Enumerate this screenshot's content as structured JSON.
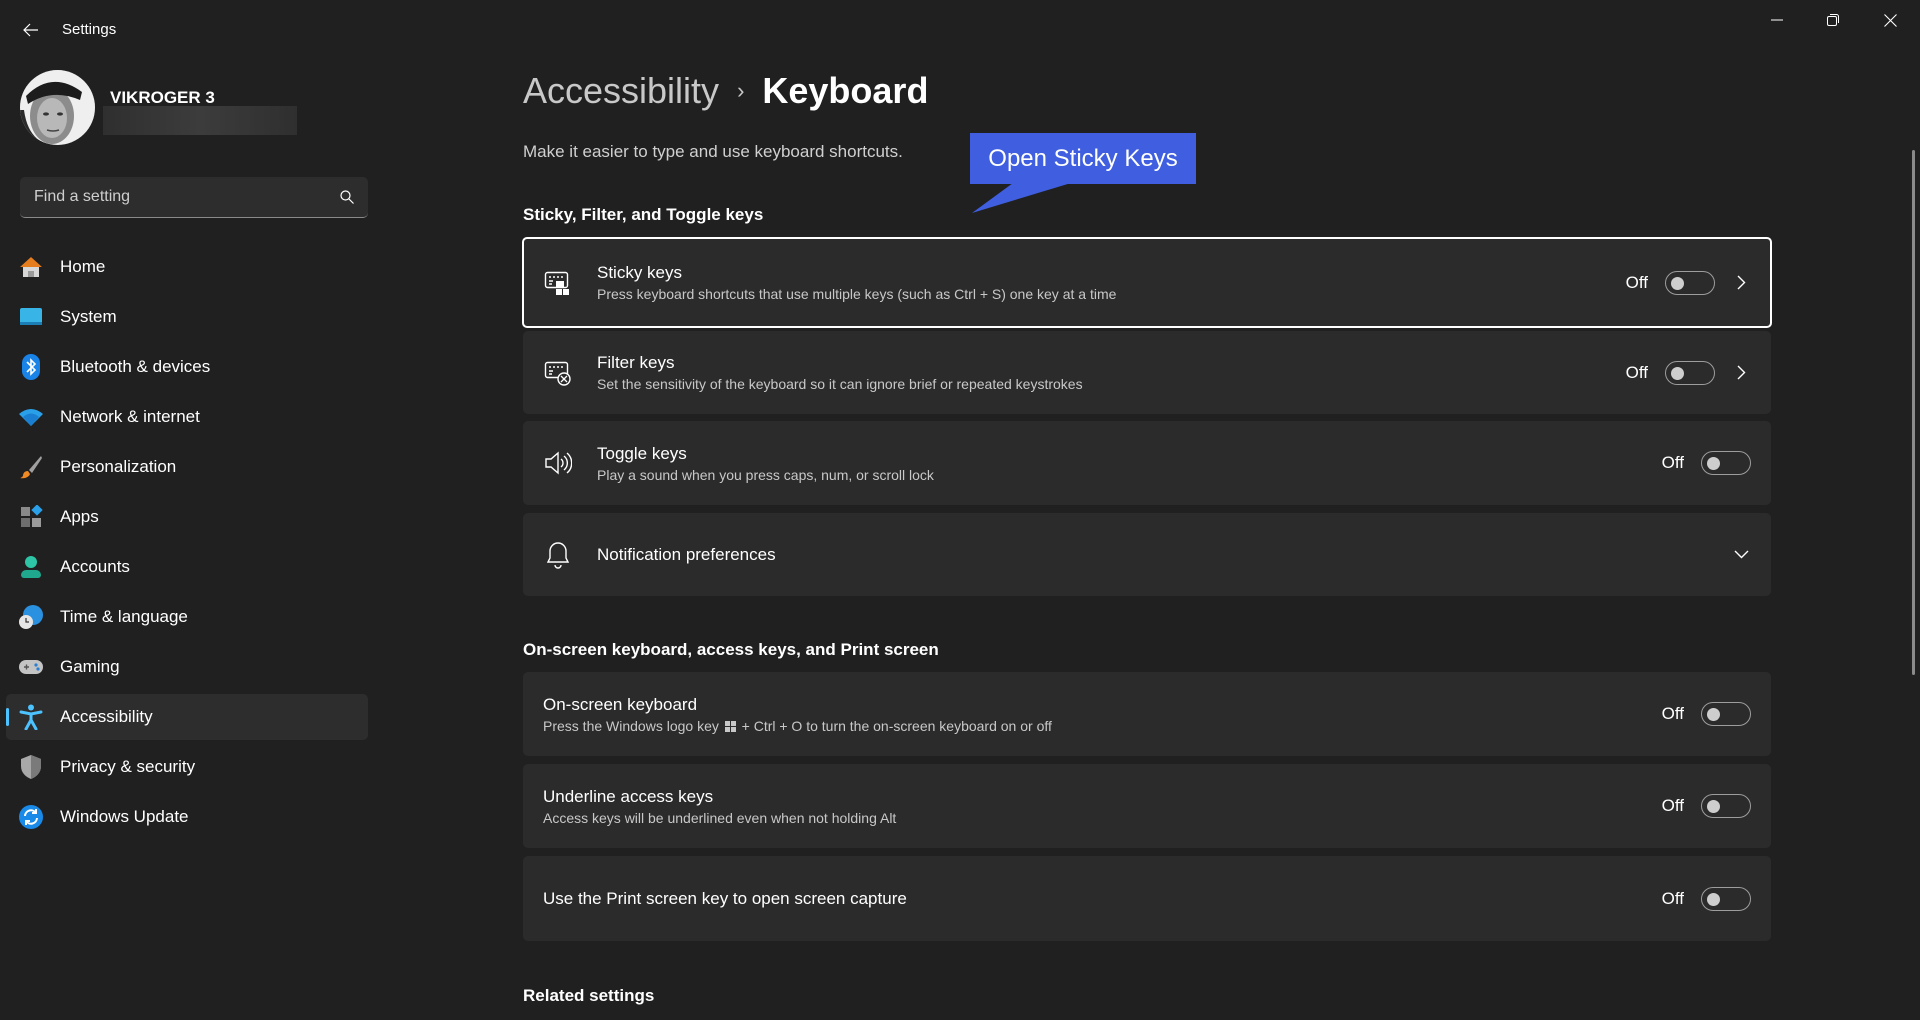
{
  "window": {
    "title": "Settings",
    "controls": [
      "minimize",
      "restore",
      "close"
    ]
  },
  "profile": {
    "name": "VIKROGER 3"
  },
  "search": {
    "placeholder": "Find a setting",
    "value": ""
  },
  "sidebar": {
    "items": [
      {
        "label": "Home",
        "icon": "home-icon",
        "selected": false
      },
      {
        "label": "System",
        "icon": "system-icon",
        "selected": false
      },
      {
        "label": "Bluetooth & devices",
        "icon": "bluetooth-icon",
        "selected": false
      },
      {
        "label": "Network & internet",
        "icon": "wifi-icon",
        "selected": false
      },
      {
        "label": "Personalization",
        "icon": "brush-icon",
        "selected": false
      },
      {
        "label": "Apps",
        "icon": "apps-icon",
        "selected": false
      },
      {
        "label": "Accounts",
        "icon": "account-icon",
        "selected": false
      },
      {
        "label": "Time & language",
        "icon": "globe-clock-icon",
        "selected": false
      },
      {
        "label": "Gaming",
        "icon": "gamepad-icon",
        "selected": false
      },
      {
        "label": "Accessibility",
        "icon": "accessibility-icon",
        "selected": true
      },
      {
        "label": "Privacy & security",
        "icon": "shield-icon",
        "selected": false
      },
      {
        "label": "Windows Update",
        "icon": "update-icon",
        "selected": false
      }
    ]
  },
  "main": {
    "breadcrumb_parent": "Accessibility",
    "breadcrumb_separator": "›",
    "breadcrumb_current": "Keyboard",
    "description": "Make it easier to type and use keyboard shortcuts.",
    "section1": {
      "title": "Sticky, Filter, and Toggle keys",
      "cards": [
        {
          "title": "Sticky keys",
          "subtitle": "Press keyboard shortcuts that use multiple keys (such as Ctrl + S) one key at a time",
          "state": "Off",
          "on": false,
          "has_chevron": true
        },
        {
          "title": "Filter keys",
          "subtitle": "Set the sensitivity of the keyboard so it can ignore brief or repeated keystrokes",
          "state": "Off",
          "on": false,
          "has_chevron": true
        },
        {
          "title": "Toggle keys",
          "subtitle": "Play a sound when you press caps, num, or scroll lock",
          "state": "Off",
          "on": false,
          "has_chevron": false
        },
        {
          "title": "Notification preferences",
          "expandable": true
        }
      ]
    },
    "section2": {
      "title": "On-screen keyboard, access keys, and Print screen",
      "cards": [
        {
          "title": "On-screen keyboard",
          "subtitle_pre": "Press the Windows logo key",
          "subtitle_post": "+ Ctrl + O to turn the on-screen keyboard on or off",
          "state": "Off",
          "on": false
        },
        {
          "title": "Underline access keys",
          "subtitle": "Access keys will be underlined even when not holding Alt",
          "state": "Off",
          "on": false
        },
        {
          "title": "Use the Print screen key to open screen capture",
          "state": "Off",
          "on": false
        }
      ]
    },
    "section3": {
      "title": "Related settings"
    }
  },
  "annotation": {
    "callout_text": "Open Sticky Keys",
    "color": "#3f5fe0"
  },
  "colors": {
    "background": "#202020",
    "card": "#2b2b2b",
    "accent": "#4cc2ff"
  }
}
